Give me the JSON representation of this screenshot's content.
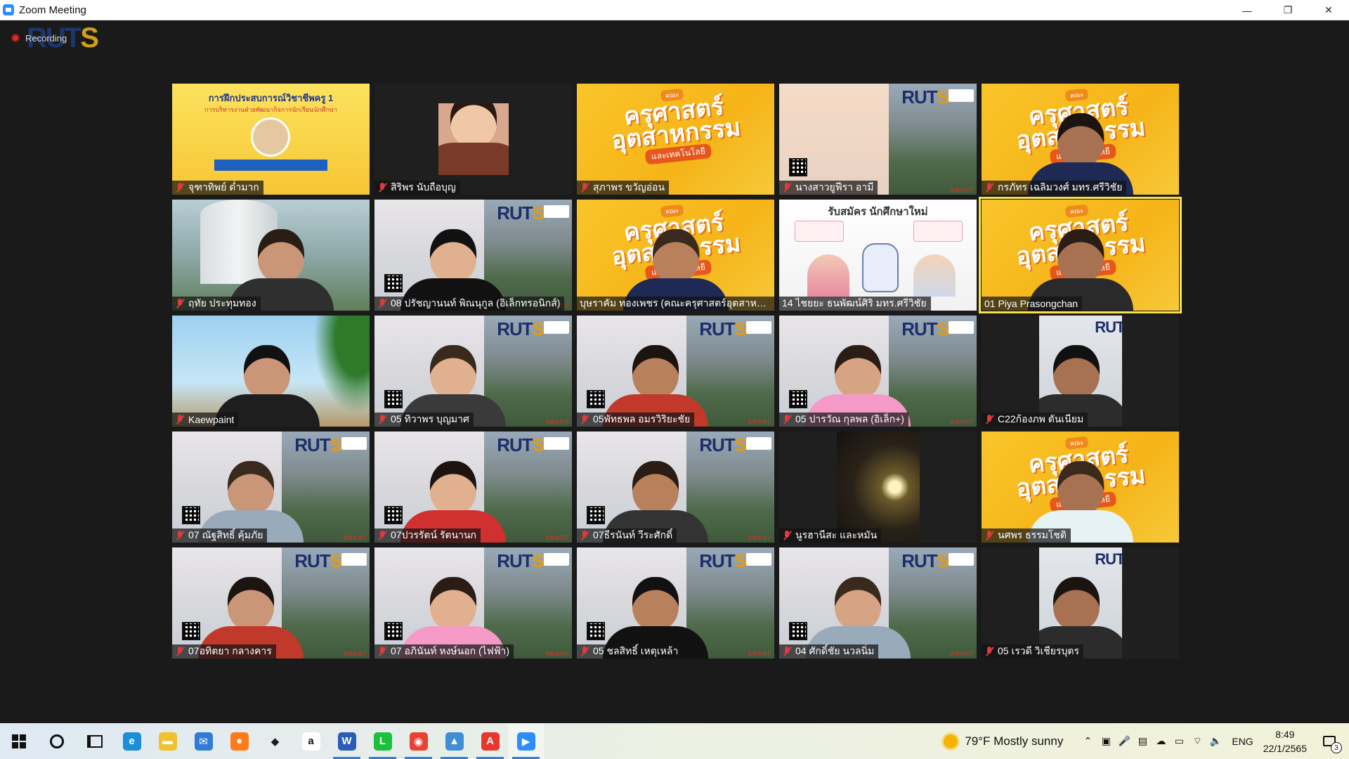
{
  "window": {
    "title": "Zoom Meeting",
    "controls": {
      "minimize": "—",
      "restore": "❐",
      "close": "✕"
    }
  },
  "meeting": {
    "recording_label": "Recording",
    "brand": {
      "part1": "RUT",
      "part2": "S"
    },
    "participants": [
      {
        "name": "จุฑาทิพย์ ด่ำมาก",
        "muted": true,
        "view": "slide"
      },
      {
        "name": "สิริพร นับถือบุญ",
        "muted": true,
        "view": "photo"
      },
      {
        "name": "สุภาพร ขวัญอ่อน",
        "muted": true,
        "view": "faculty-banner"
      },
      {
        "name": "นางสาวยูฟีรา อามี",
        "muted": true,
        "view": "ruts-peach"
      },
      {
        "name": "กรภัทร เฉลิมวงศ์ มทร.ศรีวิชัย",
        "muted": true,
        "view": "faculty-person"
      },
      {
        "name": "ฤทัย ประทุมทอง",
        "muted": true,
        "view": "building"
      },
      {
        "name": "08 ปรัชญานนท์ พิณนุกูล (อิเล็กทรอนิกส์)",
        "muted": true,
        "view": "ruts"
      },
      {
        "name": "บุษราคัม ทองเพชร (คณะครุศาสตร์อุตสาหกร...",
        "muted": false,
        "view": "faculty-person"
      },
      {
        "name": "14 ไชยยะ ธนพัฒน์ศิริ มทร.ศรีวิชัย",
        "muted": false,
        "view": "poster"
      },
      {
        "name": "01 Piya Prasongchan",
        "muted": false,
        "view": "faculty-person",
        "active_speaker": true
      },
      {
        "name": "Kaewpaint",
        "muted": true,
        "view": "beach"
      },
      {
        "name": "05 ทิวาพร บุญมาศ",
        "muted": true,
        "view": "ruts"
      },
      {
        "name": "05พัทธพล อมรวิริยะชัย",
        "muted": true,
        "view": "ruts"
      },
      {
        "name": "05 ปารวัณ กุลพล (อิเล็ก+)",
        "muted": true,
        "view": "ruts"
      },
      {
        "name": "C22ก้องภพ ตันเนียม",
        "muted": true,
        "view": "ruts-narrow"
      },
      {
        "name": "07 ณัฐสิทธิ์ คุ้มภัย",
        "muted": true,
        "view": "ruts"
      },
      {
        "name": "07ปวรรัตน์ รัตนานก",
        "muted": true,
        "view": "ruts"
      },
      {
        "name": "07ธีรนันท์ วีระศักดิ์",
        "muted": true,
        "view": "ruts"
      },
      {
        "name": "นูรฮานีสะ และหมัน",
        "muted": true,
        "view": "dark"
      },
      {
        "name": "นศพร ธรรมโชติ",
        "muted": true,
        "view": "faculty-person"
      },
      {
        "name": "07อทิตยา กลางคาร",
        "muted": true,
        "view": "ruts"
      },
      {
        "name": "07 อภินันท์ หงษ์นอก (ไฟฟ้า)",
        "muted": true,
        "view": "ruts"
      },
      {
        "name": "05 ชลสิทธิ์ เหตุเหล้า",
        "muted": true,
        "view": "ruts"
      },
      {
        "name": "04 ศักดิ์ชัย นวลนิ่ม",
        "muted": true,
        "view": "ruts"
      },
      {
        "name": "05 เรวดี วิเชียรบุตร",
        "muted": true,
        "view": "ruts-narrow"
      }
    ],
    "slide": {
      "title": "การฝึกประสบการณ์วิชาชีพครู 1",
      "subtitle": "การบริหารงานฝ่ายพัฒนากิจการนักเรียนนักศึกษา"
    },
    "faculty_banner": {
      "tag": "คณะ",
      "line1": "ครุศาสตร์",
      "line2": "อุตสาหกรรม",
      "line3": "และเทคโนโลยี"
    },
    "ruts_background": {
      "mark": "RUT",
      "mark_s": "S",
      "footer": "SMART"
    },
    "poster": {
      "title": "รับสมัคร นักศึกษาใหม่"
    }
  },
  "taskbar": {
    "apps": [
      {
        "id": "edge",
        "glyph": "e",
        "color": "#1a8fd8"
      },
      {
        "id": "file-explorer",
        "glyph": "▬",
        "color": "#f2c12e"
      },
      {
        "id": "mail",
        "glyph": "✉",
        "color": "#2f7bd6"
      },
      {
        "id": "firefox",
        "glyph": "●",
        "color": "#ff7b1a"
      },
      {
        "id": "dropbox",
        "glyph": "◆",
        "color": "#1c1c1c"
      },
      {
        "id": "amazon",
        "glyph": "a",
        "color": "#ffffff"
      },
      {
        "id": "word",
        "glyph": "W",
        "color": "#2b5cb8"
      },
      {
        "id": "line",
        "glyph": "L",
        "color": "#19c23a"
      },
      {
        "id": "chrome",
        "glyph": "◉",
        "color": "#e94235"
      },
      {
        "id": "photos",
        "glyph": "▲",
        "color": "#3e8dd6"
      },
      {
        "id": "acrobat",
        "glyph": "A",
        "color": "#e8372c"
      },
      {
        "id": "zoom",
        "glyph": "▶",
        "color": "#2d8cff"
      }
    ],
    "weather": "79°F  Mostly sunny",
    "language": "ENG",
    "time": "8:49",
    "date": "22/1/2565",
    "notification_count": "3"
  }
}
